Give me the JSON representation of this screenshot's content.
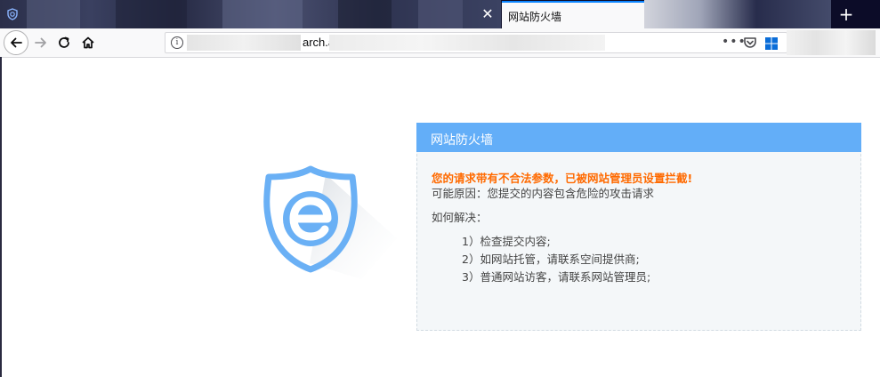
{
  "browser": {
    "active_tab": {
      "title": "网站防火墙"
    },
    "tab_close_symbol": "✕",
    "new_tab_symbol": "+",
    "url": {
      "visible_text": "arch.aspx",
      "more_symbol": "•••"
    },
    "icons": {
      "back": "arrow-left-icon",
      "forward": "arrow-right-icon",
      "reload": "reload-icon",
      "home": "home-icon",
      "site_info": "info-icon",
      "page_actions": "more-dots-icon",
      "pocket": "pocket-icon",
      "extension": "windows-logo-icon",
      "tab_favicon": "site-favicon-icon"
    },
    "colors": {
      "tab_accent": "#0a84ff",
      "tab_strip": "#0c0c28"
    }
  },
  "firewall": {
    "header_title": "网站防火墙",
    "warning": "您的请求带有不合法参数，已被网站管理员设置拦截!",
    "reason": "可能原因：您提交的内容包含危险的攻击请求",
    "how_to_solve": "如何解决：",
    "steps": [
      "1）检查提交内容;",
      "2）如网站托管，请联系空间提供商;",
      "3）普通网站访客，请联系网站管理员;"
    ],
    "logo_icon": "shield-e-logo-icon",
    "colors": {
      "header": "#63aef8",
      "warning": "#ff6a00",
      "text": "#444444",
      "logo": "#6ab0f5"
    }
  }
}
